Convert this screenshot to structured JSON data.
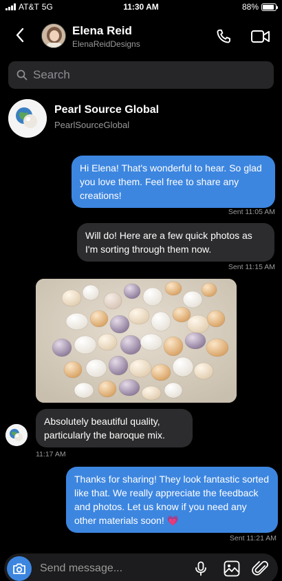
{
  "status_bar": {
    "carrier": "AT&T",
    "network": "5G",
    "time": "11:30 AM",
    "battery": "88%",
    "battery_level": 0.88
  },
  "header": {
    "name": "Elena Reid",
    "handle": "ElenaReidDesigns"
  },
  "search": {
    "placeholder": "Search"
  },
  "business": {
    "name": "Pearl Source Global",
    "handle": "PearlSourceGlobal"
  },
  "messages": [
    {
      "direction": "outgoing",
      "text": "Hi Elena! That's wonderful to hear. So glad you love them. Feel free to share any creations!",
      "status": "Sent 11:05 AM"
    },
    {
      "direction": "outgoing",
      "text": "Will do! Here are a few quick photos as I'm sorting through them now.",
      "status": "Sent 11:15 AM"
    },
    {
      "direction": "incoming",
      "type": "image",
      "alt": "pearls"
    },
    {
      "direction": "incoming",
      "text": "Absolutely beautiful quality, particularly the baroque mix.",
      "status": "11:17 AM"
    },
    {
      "direction": "outgoing",
      "text": "Thanks for sharing! They look fantastic sorted like that. We really appreciate the feedback and photos. Let us know if you need any other materials soon!",
      "emoji": "💗",
      "status": "Sent 11:21 AM"
    }
  ],
  "composer": {
    "placeholder": "Send message..."
  },
  "icons": [
    "back-icon",
    "phone-icon",
    "video-camera-icon",
    "search-icon",
    "camera-icon",
    "microphone-icon",
    "image-icon",
    "paperclip-icon"
  ],
  "colors": {
    "accent": "#3d86e0",
    "incoming_bubble": "#2c2c2e",
    "background": "#000000"
  }
}
